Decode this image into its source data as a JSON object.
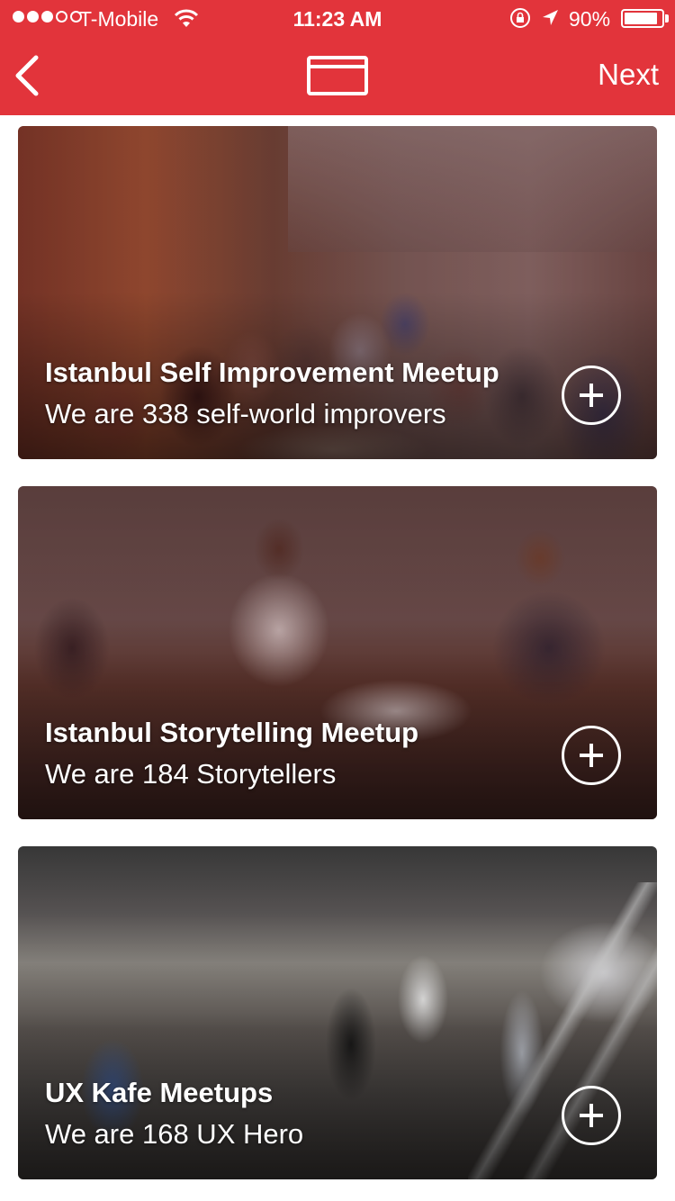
{
  "status_bar": {
    "carrier": "T-Mobile",
    "time": "11:23 AM",
    "battery": "90%",
    "signal_bars": 3,
    "battery_level": 0.9
  },
  "nav": {
    "back_icon": "chevron-left-icon",
    "center_icon": "card-icon",
    "next_label": "Next"
  },
  "colors": {
    "accent": "#e2343b"
  },
  "groups": [
    {
      "title": "Istanbul Self Improvement Meetup",
      "subtitle": "We are 338 self-world improvers"
    },
    {
      "title": "Istanbul Storytelling Meetup",
      "subtitle": "We are 184 Storytellers"
    },
    {
      "title": "UX Kafe Meetups",
      "subtitle": "We are 168 UX Hero"
    }
  ]
}
